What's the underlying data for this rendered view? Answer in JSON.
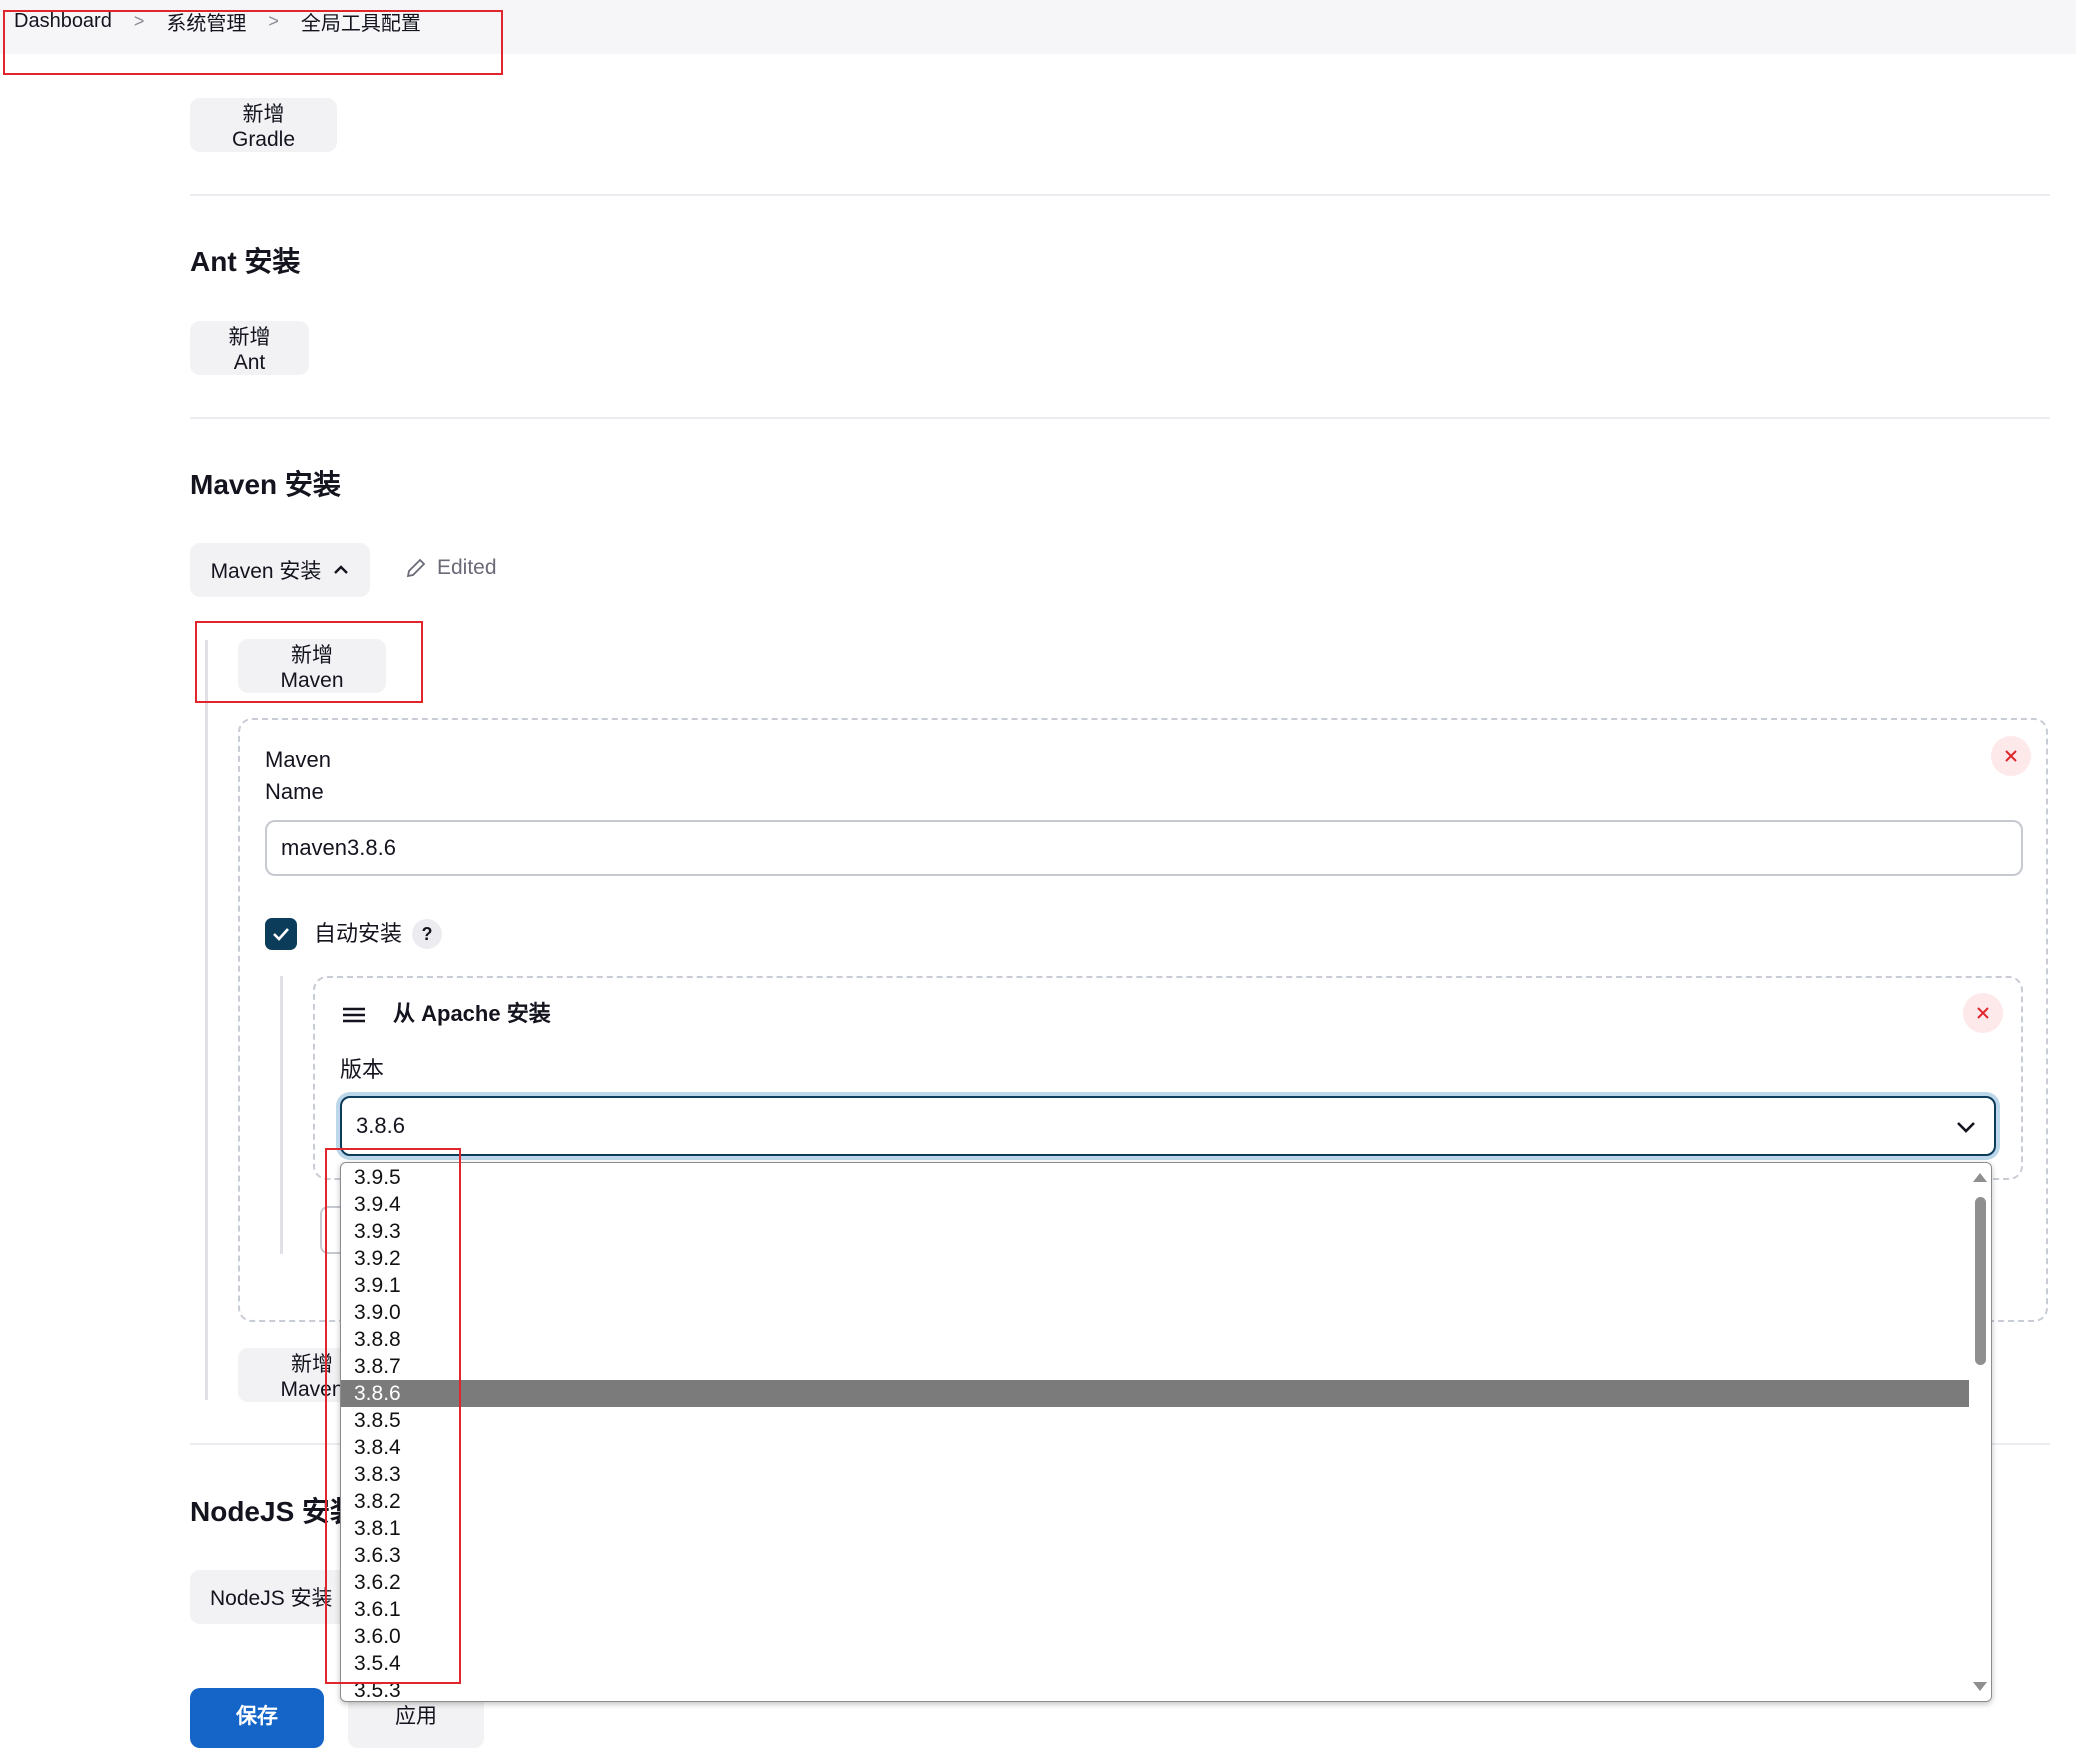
{
  "breadcrumb": {
    "items": [
      "Dashboard",
      "系统管理",
      "全局工具配置"
    ],
    "separator": ">"
  },
  "gradle": {
    "add_button": "新增 Gradle"
  },
  "ant": {
    "title": "Ant 安装",
    "add_button": "新增 Ant"
  },
  "maven": {
    "title": "Maven 安装",
    "toggle_button": "Maven 安装",
    "edited_label": "Edited",
    "add_button": "新增 Maven",
    "add_button_bottom": "新增 Maven",
    "installation": {
      "name_label_line1": "Maven",
      "name_label_line2": "Name",
      "name_value": "maven3.8.6",
      "auto_install_label": "自动安装",
      "auto_install_checked": true,
      "help_glyph": "?",
      "installer": {
        "title": "从 Apache 安装",
        "version_label": "版本",
        "selected_version": "3.8.6",
        "version_options": [
          "3.9.5",
          "3.9.4",
          "3.9.3",
          "3.9.2",
          "3.9.1",
          "3.9.0",
          "3.8.8",
          "3.8.7",
          "3.8.6",
          "3.8.5",
          "3.8.4",
          "3.8.3",
          "3.8.2",
          "3.8.1",
          "3.6.3",
          "3.6.2",
          "3.6.1",
          "3.6.0",
          "3.5.4",
          "3.5.3"
        ]
      }
    }
  },
  "nodejs": {
    "title": "NodeJS 安装",
    "toggle_button": "NodeJS 安装"
  },
  "footer": {
    "save_label": "保存",
    "apply_label": "应用"
  },
  "colors": {
    "primary": "#1565c8",
    "checkbox": "#0b3d5b",
    "highlight_box": "#e0262d",
    "danger": "#e0262d"
  }
}
